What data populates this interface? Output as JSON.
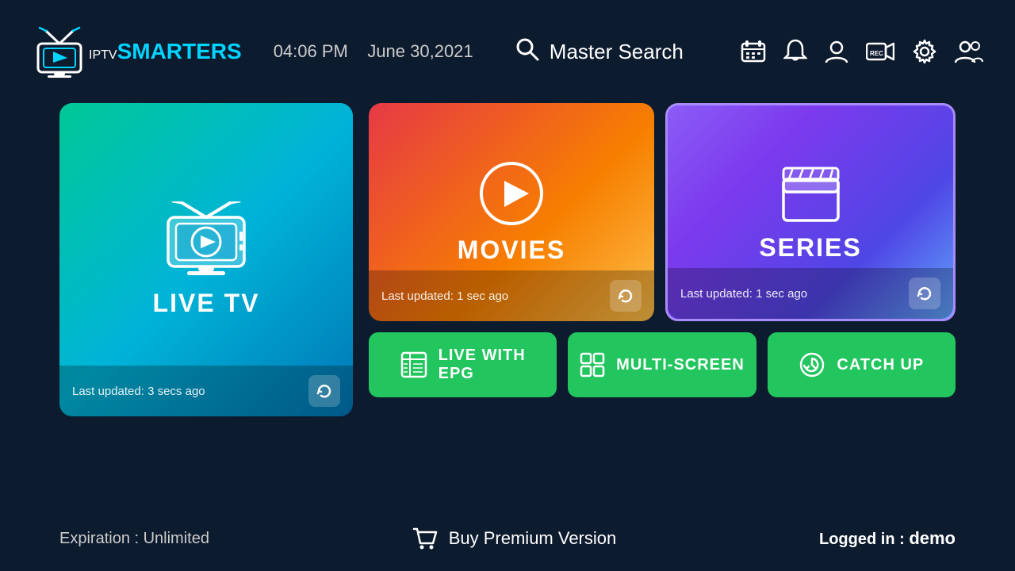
{
  "header": {
    "logo_iptv": "IPTV",
    "logo_smarters": "SMARTERS",
    "time": "04:06 PM",
    "date": "June 30,2021",
    "search_label": "Master Search",
    "icons": [
      {
        "name": "schedule-icon",
        "label": "Schedule"
      },
      {
        "name": "bell-icon",
        "label": "Notifications"
      },
      {
        "name": "profile-icon",
        "label": "Profile"
      },
      {
        "name": "record-icon",
        "label": "Record"
      },
      {
        "name": "settings-icon",
        "label": "Settings"
      },
      {
        "name": "users-icon",
        "label": "Users"
      }
    ]
  },
  "cards": {
    "live_tv": {
      "label": "LIVE TV",
      "footer": "Last updated: 3 secs ago"
    },
    "movies": {
      "label": "MOVIES",
      "footer": "Last updated: 1 sec ago"
    },
    "series": {
      "label": "SERIES",
      "footer": "Last updated: 1 sec ago"
    }
  },
  "buttons": {
    "live_epg": {
      "line1": "LIVE WITH",
      "line2": "EPG"
    },
    "multi_screen": "MULTI-SCREEN",
    "catch_up": "CATCH UP"
  },
  "footer": {
    "expiry_label": "Expiration : Unlimited",
    "buy_label": "Buy Premium Version",
    "logged_prefix": "Logged in : ",
    "logged_user": "demo"
  }
}
